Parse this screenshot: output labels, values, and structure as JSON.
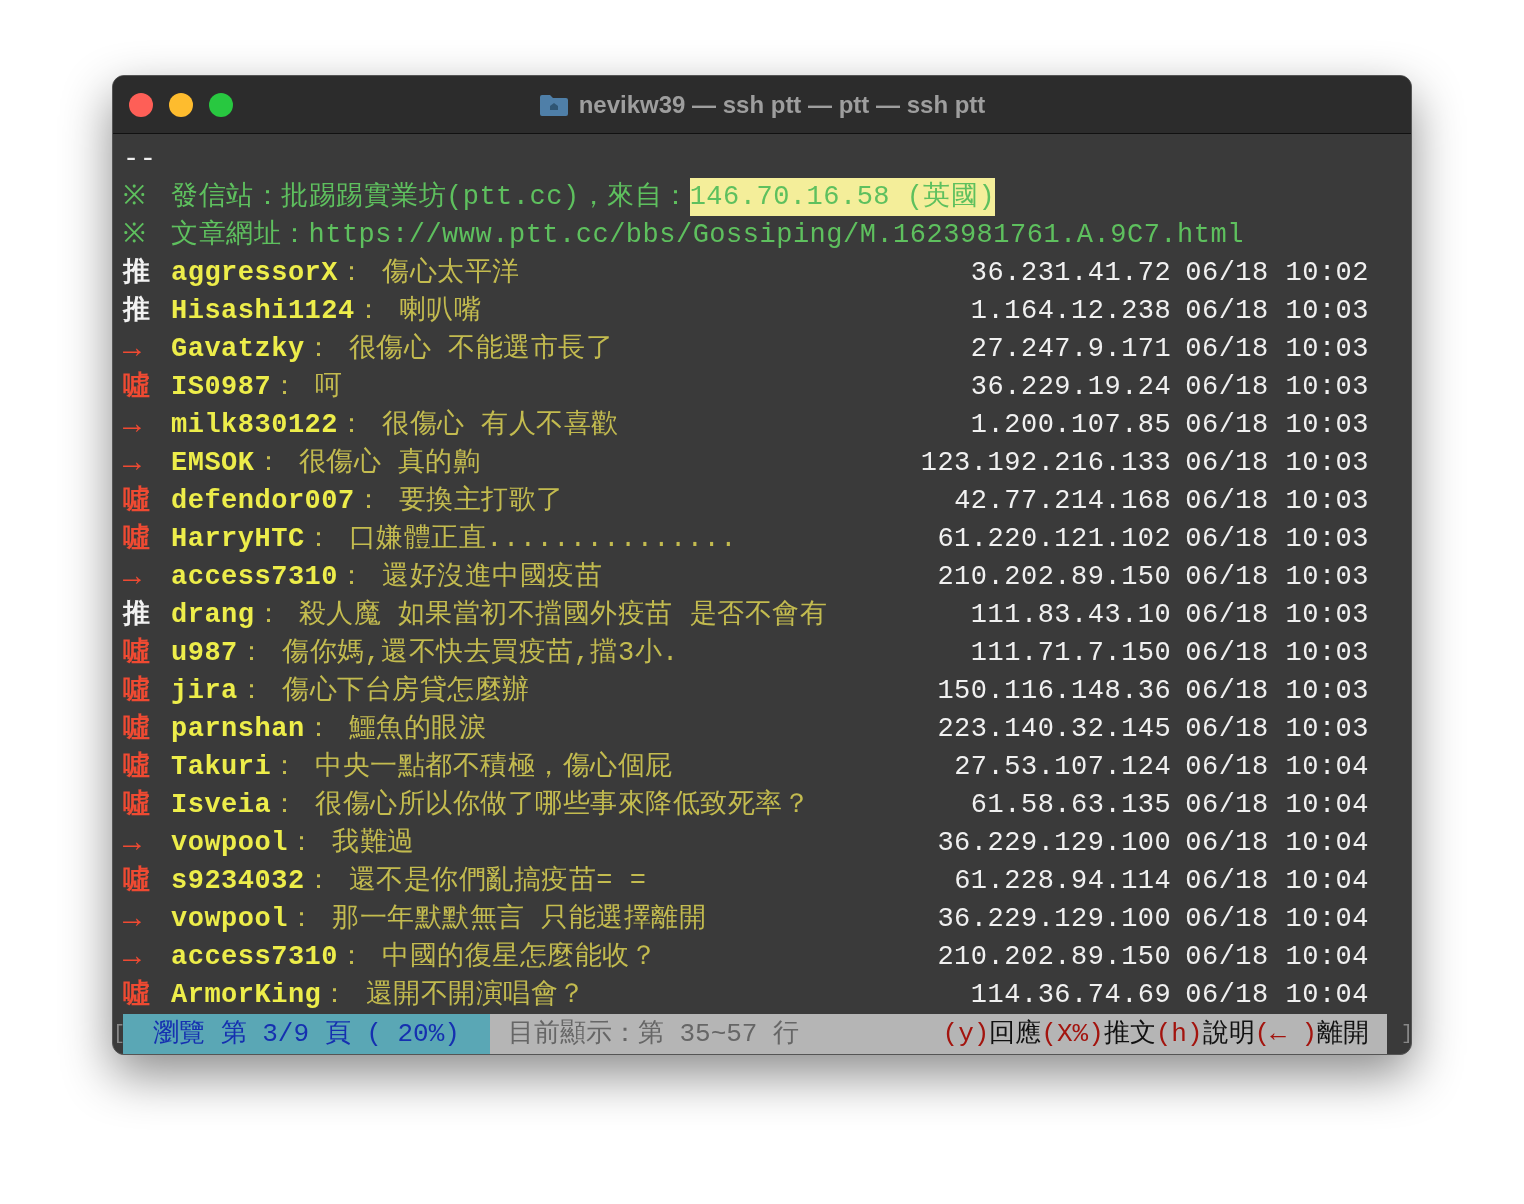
{
  "window": {
    "title": "nevikw39 — ssh ptt — ptt — ssh ptt"
  },
  "header": {
    "separator": "--",
    "origin": {
      "mark": "※",
      "label": "發信站：批踢踢實業坊(ptt.cc)，來自：",
      "highlight": "146.70.16.58 (英國)"
    },
    "url": {
      "mark": "※",
      "label": "文章網址：",
      "value": "https://www.ptt.cc/bbs/Gossiping/M.1623981761.A.9C7.html"
    }
  },
  "comments": [
    {
      "kind": "push",
      "tag": "推",
      "user": "aggressorX",
      "text": "： 傷心太平洋",
      "ip": "36.231.41.72",
      "time": "06/18 10:02"
    },
    {
      "kind": "push",
      "tag": "推",
      "user": "Hisashi1124",
      "text": "： 喇叭嘴",
      "ip": "1.164.12.238",
      "time": "06/18 10:03"
    },
    {
      "kind": "arrow",
      "tag": "→",
      "user": "Gavatzky",
      "text": "： 很傷心 不能選市長了",
      "ip": "27.247.9.171",
      "time": "06/18 10:03"
    },
    {
      "kind": "boo",
      "tag": "噓",
      "user": "IS0987",
      "text": "： 呵",
      "ip": "36.229.19.24",
      "time": "06/18 10:03"
    },
    {
      "kind": "arrow",
      "tag": "→",
      "user": "milk830122",
      "text": "： 很傷心 有人不喜歡",
      "ip": "1.200.107.85",
      "time": "06/18 10:03"
    },
    {
      "kind": "arrow",
      "tag": "→",
      "user": "EMSOK",
      "text": "： 很傷心 真的齁",
      "ip": "123.192.216.133",
      "time": "06/18 10:03"
    },
    {
      "kind": "boo",
      "tag": "噓",
      "user": "defendor007",
      "text": "： 要換主打歌了",
      "ip": "42.77.214.168",
      "time": "06/18 10:03"
    },
    {
      "kind": "boo",
      "tag": "噓",
      "user": "HarryHTC",
      "text": "： 口嫌體正直...............",
      "ip": "61.220.121.102",
      "time": "06/18 10:03"
    },
    {
      "kind": "arrow",
      "tag": "→",
      "user": "access7310",
      "text": "： 還好沒進中國疫苗",
      "ip": "210.202.89.150",
      "time": "06/18 10:03"
    },
    {
      "kind": "push",
      "tag": "推",
      "user": "drang",
      "text": "： 殺人魔 如果當初不擋國外疫苗 是否不會有",
      "ip": "111.83.43.10",
      "time": "06/18 10:03"
    },
    {
      "kind": "boo",
      "tag": "噓",
      "user": "u987",
      "text": "： 傷你媽,還不快去買疫苗,擋3小.",
      "ip": "111.71.7.150",
      "time": "06/18 10:03"
    },
    {
      "kind": "boo",
      "tag": "噓",
      "user": "jira",
      "text": "： 傷心下台房貸怎麼辦",
      "ip": "150.116.148.36",
      "time": "06/18 10:03"
    },
    {
      "kind": "boo",
      "tag": "噓",
      "user": "parnshan",
      "text": "： 鱷魚的眼淚",
      "ip": "223.140.32.145",
      "time": "06/18 10:03"
    },
    {
      "kind": "boo",
      "tag": "噓",
      "user": "Takuri",
      "text": "： 中央一點都不積極，傷心個屁",
      "ip": "27.53.107.124",
      "time": "06/18 10:04"
    },
    {
      "kind": "boo",
      "tag": "噓",
      "user": "Isveia",
      "text": "： 很傷心所以你做了哪些事來降低致死率？",
      "ip": "61.58.63.135",
      "time": "06/18 10:04"
    },
    {
      "kind": "arrow",
      "tag": "→",
      "user": "vowpool",
      "text": "： 我難過",
      "ip": "36.229.129.100",
      "time": "06/18 10:04"
    },
    {
      "kind": "boo",
      "tag": "噓",
      "user": "s9234032",
      "text": "： 還不是你們亂搞疫苗= =",
      "ip": "61.228.94.114",
      "time": "06/18 10:04"
    },
    {
      "kind": "arrow",
      "tag": "→",
      "user": "vowpool",
      "text": "： 那一年默默無言 只能選擇離開",
      "ip": "36.229.129.100",
      "time": "06/18 10:04"
    },
    {
      "kind": "arrow",
      "tag": "→",
      "user": "access7310",
      "text": "： 中國的復星怎麼能收？",
      "ip": "210.202.89.150",
      "time": "06/18 10:04"
    },
    {
      "kind": "boo",
      "tag": "噓",
      "user": "ArmorKing",
      "text": "： 還開不開演唱會？",
      "ip": "114.36.74.69",
      "time": "06/18 10:04"
    }
  ],
  "status_bar": {
    "left_bracket": "[",
    "page": "瀏覽 第 3/9 頁 ( 20%)",
    "range": "目前顯示：第 35~57 行",
    "hints": [
      {
        "key": "(y)",
        "label": "回應"
      },
      {
        "key": "(X%)",
        "label": "推文"
      },
      {
        "key": "(h)",
        "label": "說明"
      },
      {
        "key": "(← )",
        "label": "離開"
      }
    ],
    "right_bracket": "]"
  }
}
